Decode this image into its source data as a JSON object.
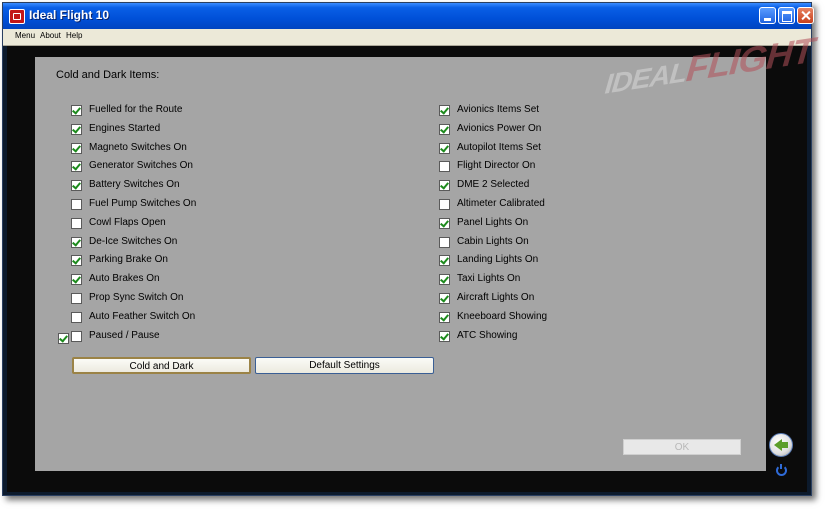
{
  "window": {
    "title": "Ideal Flight 10"
  },
  "menu": [
    "Menu",
    "About",
    "Help"
  ],
  "watermark": {
    "part1": "IDEAL",
    "part2": "FLIGHT"
  },
  "section_heading": "Cold and Dark Items:",
  "left_items": [
    {
      "label": "Fuelled for the Route",
      "checked": true
    },
    {
      "label": "Engines Started",
      "checked": true
    },
    {
      "label": "Magneto Switches On",
      "checked": true
    },
    {
      "label": "Generator Switches On",
      "checked": true
    },
    {
      "label": "Battery Switches On",
      "checked": true
    },
    {
      "label": "Fuel Pump Switches On",
      "checked": false
    },
    {
      "label": "Cowl Flaps Open",
      "checked": false
    },
    {
      "label": "De-Ice Switches On",
      "checked": true
    },
    {
      "label": "Parking Brake On",
      "checked": true
    },
    {
      "label": "Auto Brakes On",
      "checked": true
    },
    {
      "label": "Prop Sync Switch On",
      "checked": false
    },
    {
      "label": "Auto Feather Switch On",
      "checked": false
    },
    {
      "label": "Paused / Pause",
      "checked": false
    }
  ],
  "extra_checkbox": {
    "checked": true
  },
  "right_items": [
    {
      "label": "Avionics Items Set",
      "checked": true
    },
    {
      "label": "Avionics Power On",
      "checked": true
    },
    {
      "label": "Autopilot Items Set",
      "checked": true
    },
    {
      "label": "Flight Director On",
      "checked": false
    },
    {
      "label": "DME 2 Selected",
      "checked": true
    },
    {
      "label": "Altimeter Calibrated",
      "checked": false
    },
    {
      "label": "Panel Lights On",
      "checked": true
    },
    {
      "label": "Cabin Lights On",
      "checked": false
    },
    {
      "label": "Landing Lights On",
      "checked": true
    },
    {
      "label": "Taxi Lights On",
      "checked": true
    },
    {
      "label": "Aircraft Lights On",
      "checked": true
    },
    {
      "label": "Kneeboard Showing",
      "checked": true
    },
    {
      "label": "ATC Showing",
      "checked": true
    }
  ],
  "buttons": {
    "cold_dark": "Cold and Dark",
    "default_settings": "Default Settings",
    "ok": "OK"
  },
  "colors": {
    "panel_bg": "#a5a5a5",
    "check_green": "#1c8a1c",
    "titlebar_blue": "#0050d8"
  }
}
